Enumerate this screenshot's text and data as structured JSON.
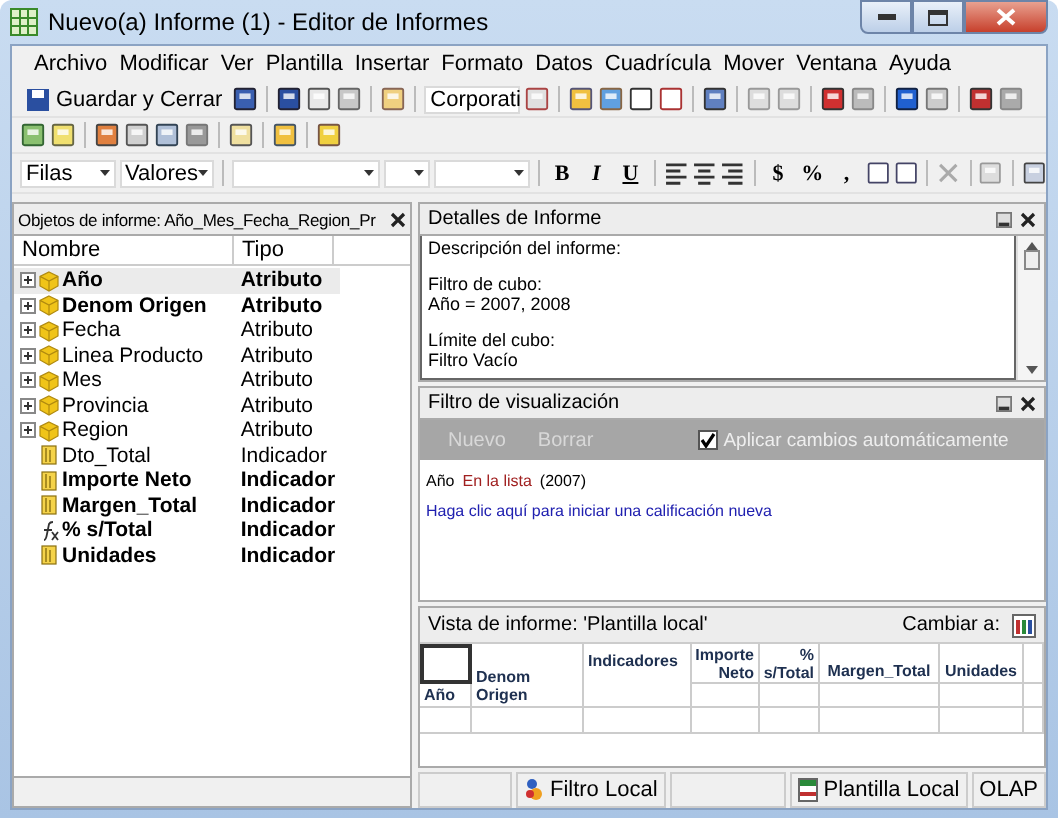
{
  "window": {
    "title": "Nuevo(a) Informe (1) - Editor de Informes"
  },
  "menu": [
    "Archivo",
    "Modificar",
    "Ver",
    "Plantilla",
    "Insertar",
    "Formato",
    "Datos",
    "Cuadrícula",
    "Mover",
    "Ventana",
    "Ayuda"
  ],
  "toolbar": {
    "save_label": "Guardar y Cerrar",
    "style_dropdown": "Corporati",
    "pivot_dropdowns": [
      "Filas",
      "Valores"
    ],
    "format_buttons": [
      "B",
      "I",
      "U"
    ],
    "number_buttons": [
      "$",
      "%",
      ","
    ]
  },
  "objects_panel": {
    "title": "Objetos de informe: Año_Mes_Fecha_Region_Pr",
    "columns": [
      "Nombre",
      "Tipo"
    ],
    "rows": [
      {
        "name": "Año",
        "type": "Atributo",
        "kind": "attribute",
        "bold": true,
        "selected": true
      },
      {
        "name": "Denom Origen",
        "type": "Atributo",
        "kind": "attribute",
        "bold": true,
        "selected": false
      },
      {
        "name": "Fecha",
        "type": "Atributo",
        "kind": "attribute",
        "bold": false,
        "selected": false
      },
      {
        "name": "Linea Producto",
        "type": "Atributo",
        "kind": "attribute",
        "bold": false,
        "selected": false
      },
      {
        "name": "Mes",
        "type": "Atributo",
        "kind": "attribute",
        "bold": false,
        "selected": false
      },
      {
        "name": "Provincia",
        "type": "Atributo",
        "kind": "attribute",
        "bold": false,
        "selected": false
      },
      {
        "name": "Region",
        "type": "Atributo",
        "kind": "attribute",
        "bold": false,
        "selected": false
      },
      {
        "name": "Dto_Total",
        "type": "Indicador",
        "kind": "metric",
        "bold": false,
        "selected": false
      },
      {
        "name": "Importe Neto",
        "type": "Indicador",
        "kind": "metric",
        "bold": true,
        "selected": false
      },
      {
        "name": "Margen_Total",
        "type": "Indicador",
        "kind": "metric",
        "bold": true,
        "selected": false
      },
      {
        "name": "% s/Total",
        "type": "Indicador",
        "kind": "formula",
        "bold": true,
        "selected": false
      },
      {
        "name": "Unidades",
        "type": "Indicador",
        "kind": "metric",
        "bold": true,
        "selected": false
      }
    ]
  },
  "details_panel": {
    "title": "Detalles de Informe",
    "sections": [
      {
        "heading": "Descripción del informe:"
      },
      {
        "heading": "Filtro de cubo:",
        "value": "Año = 2007, 2008"
      },
      {
        "heading": "Límite del cubo:",
        "value": "Filtro Vacío"
      }
    ]
  },
  "filter_panel": {
    "title": "Filtro de visualización",
    "buttons": [
      {
        "label": "Nuevo",
        "disabled": true
      },
      {
        "label": "Borrar",
        "disabled": true
      }
    ],
    "auto_apply": {
      "label": "Aplicar cambios automáticamente",
      "checked": true
    },
    "condition": {
      "attribute": "Año",
      "operator": "En la lista",
      "values": "(2007)"
    },
    "new_link": "Haga clic aquí para iniciar una calificación nueva"
  },
  "view_panel": {
    "title": "Vista de informe: 'Plantilla local'",
    "switch_label": "Cambiar a:",
    "row_headers": [
      "Año",
      "Denom Origen"
    ],
    "column_header": "Indicadores",
    "metrics": [
      "Importe Neto",
      "% s/Total",
      "Margen_Total",
      "Unidades"
    ]
  },
  "status_bar": [
    "Filtro Local",
    "Plantilla Local",
    "OLAP"
  ]
}
